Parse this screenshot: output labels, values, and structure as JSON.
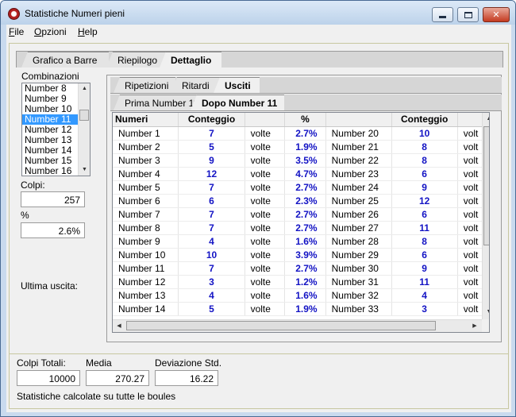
{
  "window": {
    "title": "Statistiche Numeri pieni",
    "icon": "app-icon"
  },
  "menu": [
    "File",
    "Opzioni",
    "Help"
  ],
  "tabs_top": [
    "Grafico a Barre",
    "Riepilogo",
    "Dettaglio"
  ],
  "tabs_mid": [
    "Ripetizioni",
    "Ritardi",
    "Usciti"
  ],
  "tabs_low": [
    "Prima Number 11",
    "Dopo Number 11"
  ],
  "left": {
    "combinazioni_label": "Combinazioni",
    "list": [
      "Number 8",
      "Number 9",
      "Number 10",
      "Number 11",
      "Number 12",
      "Number 13",
      "Number 14",
      "Number 15",
      "Number 16"
    ],
    "selected": "Number 11",
    "colpi_label": "Colpi:",
    "colpi_value": "257",
    "pct_label": "%",
    "pct_value": "2.6%",
    "ultima_label": "Ultima uscita:"
  },
  "grid": {
    "headers": [
      "Numeri",
      "Conteggio",
      "",
      "%",
      "",
      "Conteggio",
      ""
    ],
    "volte": "volte",
    "volte_cut": "volt",
    "rows": [
      {
        "n1": "Number 1",
        "c1": "7",
        "p1": "2.7%",
        "n2": "Number 20",
        "c2": "10"
      },
      {
        "n1": "Number 2",
        "c1": "5",
        "p1": "1.9%",
        "n2": "Number 21",
        "c2": "8"
      },
      {
        "n1": "Number 3",
        "c1": "9",
        "p1": "3.5%",
        "n2": "Number 22",
        "c2": "8"
      },
      {
        "n1": "Number 4",
        "c1": "12",
        "p1": "4.7%",
        "n2": "Number 23",
        "c2": "6"
      },
      {
        "n1": "Number 5",
        "c1": "7",
        "p1": "2.7%",
        "n2": "Number 24",
        "c2": "9"
      },
      {
        "n1": "Number 6",
        "c1": "6",
        "p1": "2.3%",
        "n2": "Number 25",
        "c2": "12"
      },
      {
        "n1": "Number 7",
        "c1": "7",
        "p1": "2.7%",
        "n2": "Number 26",
        "c2": "6"
      },
      {
        "n1": "Number 8",
        "c1": "7",
        "p1": "2.7%",
        "n2": "Number 27",
        "c2": "11"
      },
      {
        "n1": "Number 9",
        "c1": "4",
        "p1": "1.6%",
        "n2": "Number 28",
        "c2": "8"
      },
      {
        "n1": "Number 10",
        "c1": "10",
        "p1": "3.9%",
        "n2": "Number 29",
        "c2": "6"
      },
      {
        "n1": "Number 11",
        "c1": "7",
        "p1": "2.7%",
        "n2": "Number 30",
        "c2": "9"
      },
      {
        "n1": "Number 12",
        "c1": "3",
        "p1": "1.2%",
        "n2": "Number 31",
        "c2": "11"
      },
      {
        "n1": "Number 13",
        "c1": "4",
        "p1": "1.6%",
        "n2": "Number 32",
        "c2": "4"
      },
      {
        "n1": "Number 14",
        "c1": "5",
        "p1": "1.9%",
        "n2": "Number 33",
        "c2": "3"
      }
    ]
  },
  "bottom": {
    "colpi_totali_label": "Colpi Totali:",
    "colpi_totali_value": "10000",
    "media_label": "Media",
    "media_value": "270.27",
    "dev_label": "Deviazione Std.",
    "dev_value": "16.22",
    "note": "Statistiche calcolate su tutte le boules"
  },
  "colors": {
    "count_blue": "#1313c4",
    "selection": "#3399ff"
  }
}
